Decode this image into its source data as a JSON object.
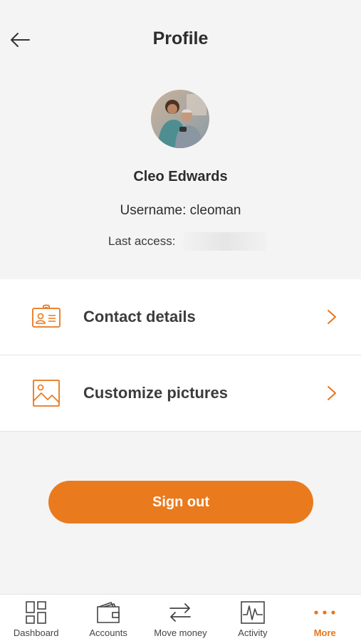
{
  "header": {
    "title": "Profile"
  },
  "profile": {
    "name": "Cleo Edwards",
    "username_text": "Username: cleoman",
    "last_access_label": "Last access:"
  },
  "menu": {
    "items": [
      {
        "label": "Contact details",
        "icon": "contact-card-icon"
      },
      {
        "label": "Customize pictures",
        "icon": "image-icon"
      }
    ]
  },
  "signout": {
    "label": "Sign out"
  },
  "bottom_nav": {
    "items": [
      {
        "label": "Dashboard",
        "icon": "dashboard-icon"
      },
      {
        "label": "Accounts",
        "icon": "wallet-icon"
      },
      {
        "label": "Move money",
        "icon": "transfer-arrows-icon"
      },
      {
        "label": "Activity",
        "icon": "activity-chart-icon"
      },
      {
        "label": "More",
        "icon": "more-dots-icon",
        "active": true
      }
    ]
  },
  "colors": {
    "accent": "#ea7a1e",
    "background": "#f4f4f4",
    "text": "#2d2d2d"
  }
}
